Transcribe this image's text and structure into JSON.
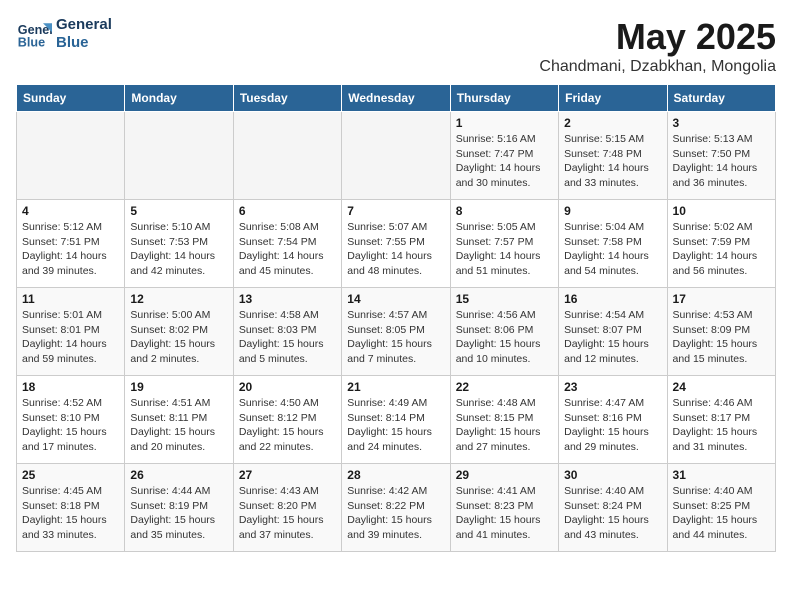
{
  "header": {
    "logo_line1": "General",
    "logo_line2": "Blue",
    "month": "May 2025",
    "location": "Chandmani, Dzabkhan, Mongolia"
  },
  "weekdays": [
    "Sunday",
    "Monday",
    "Tuesday",
    "Wednesday",
    "Thursday",
    "Friday",
    "Saturday"
  ],
  "weeks": [
    [
      {
        "day": "",
        "info": ""
      },
      {
        "day": "",
        "info": ""
      },
      {
        "day": "",
        "info": ""
      },
      {
        "day": "",
        "info": ""
      },
      {
        "day": "1",
        "info": "Sunrise: 5:16 AM\nSunset: 7:47 PM\nDaylight: 14 hours\nand 30 minutes."
      },
      {
        "day": "2",
        "info": "Sunrise: 5:15 AM\nSunset: 7:48 PM\nDaylight: 14 hours\nand 33 minutes."
      },
      {
        "day": "3",
        "info": "Sunrise: 5:13 AM\nSunset: 7:50 PM\nDaylight: 14 hours\nand 36 minutes."
      }
    ],
    [
      {
        "day": "4",
        "info": "Sunrise: 5:12 AM\nSunset: 7:51 PM\nDaylight: 14 hours\nand 39 minutes."
      },
      {
        "day": "5",
        "info": "Sunrise: 5:10 AM\nSunset: 7:53 PM\nDaylight: 14 hours\nand 42 minutes."
      },
      {
        "day": "6",
        "info": "Sunrise: 5:08 AM\nSunset: 7:54 PM\nDaylight: 14 hours\nand 45 minutes."
      },
      {
        "day": "7",
        "info": "Sunrise: 5:07 AM\nSunset: 7:55 PM\nDaylight: 14 hours\nand 48 minutes."
      },
      {
        "day": "8",
        "info": "Sunrise: 5:05 AM\nSunset: 7:57 PM\nDaylight: 14 hours\nand 51 minutes."
      },
      {
        "day": "9",
        "info": "Sunrise: 5:04 AM\nSunset: 7:58 PM\nDaylight: 14 hours\nand 54 minutes."
      },
      {
        "day": "10",
        "info": "Sunrise: 5:02 AM\nSunset: 7:59 PM\nDaylight: 14 hours\nand 56 minutes."
      }
    ],
    [
      {
        "day": "11",
        "info": "Sunrise: 5:01 AM\nSunset: 8:01 PM\nDaylight: 14 hours\nand 59 minutes."
      },
      {
        "day": "12",
        "info": "Sunrise: 5:00 AM\nSunset: 8:02 PM\nDaylight: 15 hours\nand 2 minutes."
      },
      {
        "day": "13",
        "info": "Sunrise: 4:58 AM\nSunset: 8:03 PM\nDaylight: 15 hours\nand 5 minutes."
      },
      {
        "day": "14",
        "info": "Sunrise: 4:57 AM\nSunset: 8:05 PM\nDaylight: 15 hours\nand 7 minutes."
      },
      {
        "day": "15",
        "info": "Sunrise: 4:56 AM\nSunset: 8:06 PM\nDaylight: 15 hours\nand 10 minutes."
      },
      {
        "day": "16",
        "info": "Sunrise: 4:54 AM\nSunset: 8:07 PM\nDaylight: 15 hours\nand 12 minutes."
      },
      {
        "day": "17",
        "info": "Sunrise: 4:53 AM\nSunset: 8:09 PM\nDaylight: 15 hours\nand 15 minutes."
      }
    ],
    [
      {
        "day": "18",
        "info": "Sunrise: 4:52 AM\nSunset: 8:10 PM\nDaylight: 15 hours\nand 17 minutes."
      },
      {
        "day": "19",
        "info": "Sunrise: 4:51 AM\nSunset: 8:11 PM\nDaylight: 15 hours\nand 20 minutes."
      },
      {
        "day": "20",
        "info": "Sunrise: 4:50 AM\nSunset: 8:12 PM\nDaylight: 15 hours\nand 22 minutes."
      },
      {
        "day": "21",
        "info": "Sunrise: 4:49 AM\nSunset: 8:14 PM\nDaylight: 15 hours\nand 24 minutes."
      },
      {
        "day": "22",
        "info": "Sunrise: 4:48 AM\nSunset: 8:15 PM\nDaylight: 15 hours\nand 27 minutes."
      },
      {
        "day": "23",
        "info": "Sunrise: 4:47 AM\nSunset: 8:16 PM\nDaylight: 15 hours\nand 29 minutes."
      },
      {
        "day": "24",
        "info": "Sunrise: 4:46 AM\nSunset: 8:17 PM\nDaylight: 15 hours\nand 31 minutes."
      }
    ],
    [
      {
        "day": "25",
        "info": "Sunrise: 4:45 AM\nSunset: 8:18 PM\nDaylight: 15 hours\nand 33 minutes."
      },
      {
        "day": "26",
        "info": "Sunrise: 4:44 AM\nSunset: 8:19 PM\nDaylight: 15 hours\nand 35 minutes."
      },
      {
        "day": "27",
        "info": "Sunrise: 4:43 AM\nSunset: 8:20 PM\nDaylight: 15 hours\nand 37 minutes."
      },
      {
        "day": "28",
        "info": "Sunrise: 4:42 AM\nSunset: 8:22 PM\nDaylight: 15 hours\nand 39 minutes."
      },
      {
        "day": "29",
        "info": "Sunrise: 4:41 AM\nSunset: 8:23 PM\nDaylight: 15 hours\nand 41 minutes."
      },
      {
        "day": "30",
        "info": "Sunrise: 4:40 AM\nSunset: 8:24 PM\nDaylight: 15 hours\nand 43 minutes."
      },
      {
        "day": "31",
        "info": "Sunrise: 4:40 AM\nSunset: 8:25 PM\nDaylight: 15 hours\nand 44 minutes."
      }
    ]
  ]
}
